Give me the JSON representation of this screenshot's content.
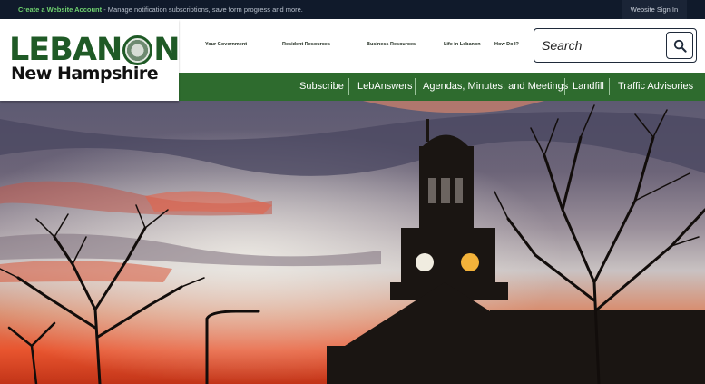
{
  "topbar": {
    "create_account_link": "Create a Website Account",
    "create_account_text": " - Manage notification subscriptions, save form progress and more.",
    "sign_in": "Website Sign In"
  },
  "logo": {
    "word_left": "LEBAN",
    "word_right": "N",
    "subtitle": "New Hampshire"
  },
  "nav": {
    "items": [
      {
        "label": "Your Government"
      },
      {
        "label": "Resident Resources"
      },
      {
        "label": "Business Resources"
      },
      {
        "label": "Life in Lebanon"
      },
      {
        "label": "How Do I?"
      }
    ]
  },
  "search": {
    "placeholder": "Search",
    "icon": "search-icon"
  },
  "quicklinks": {
    "items": [
      {
        "label": "Subscribe"
      },
      {
        "label": "LebAnswers"
      },
      {
        "label": "Agendas, Minutes, and Meetings"
      },
      {
        "label": "Landfill"
      },
      {
        "label": "Traffic Advisories"
      }
    ]
  },
  "colors": {
    "brand_green": "#2e6b2e",
    "logo_green": "#1f5a26",
    "topbar": "#101a2b"
  }
}
